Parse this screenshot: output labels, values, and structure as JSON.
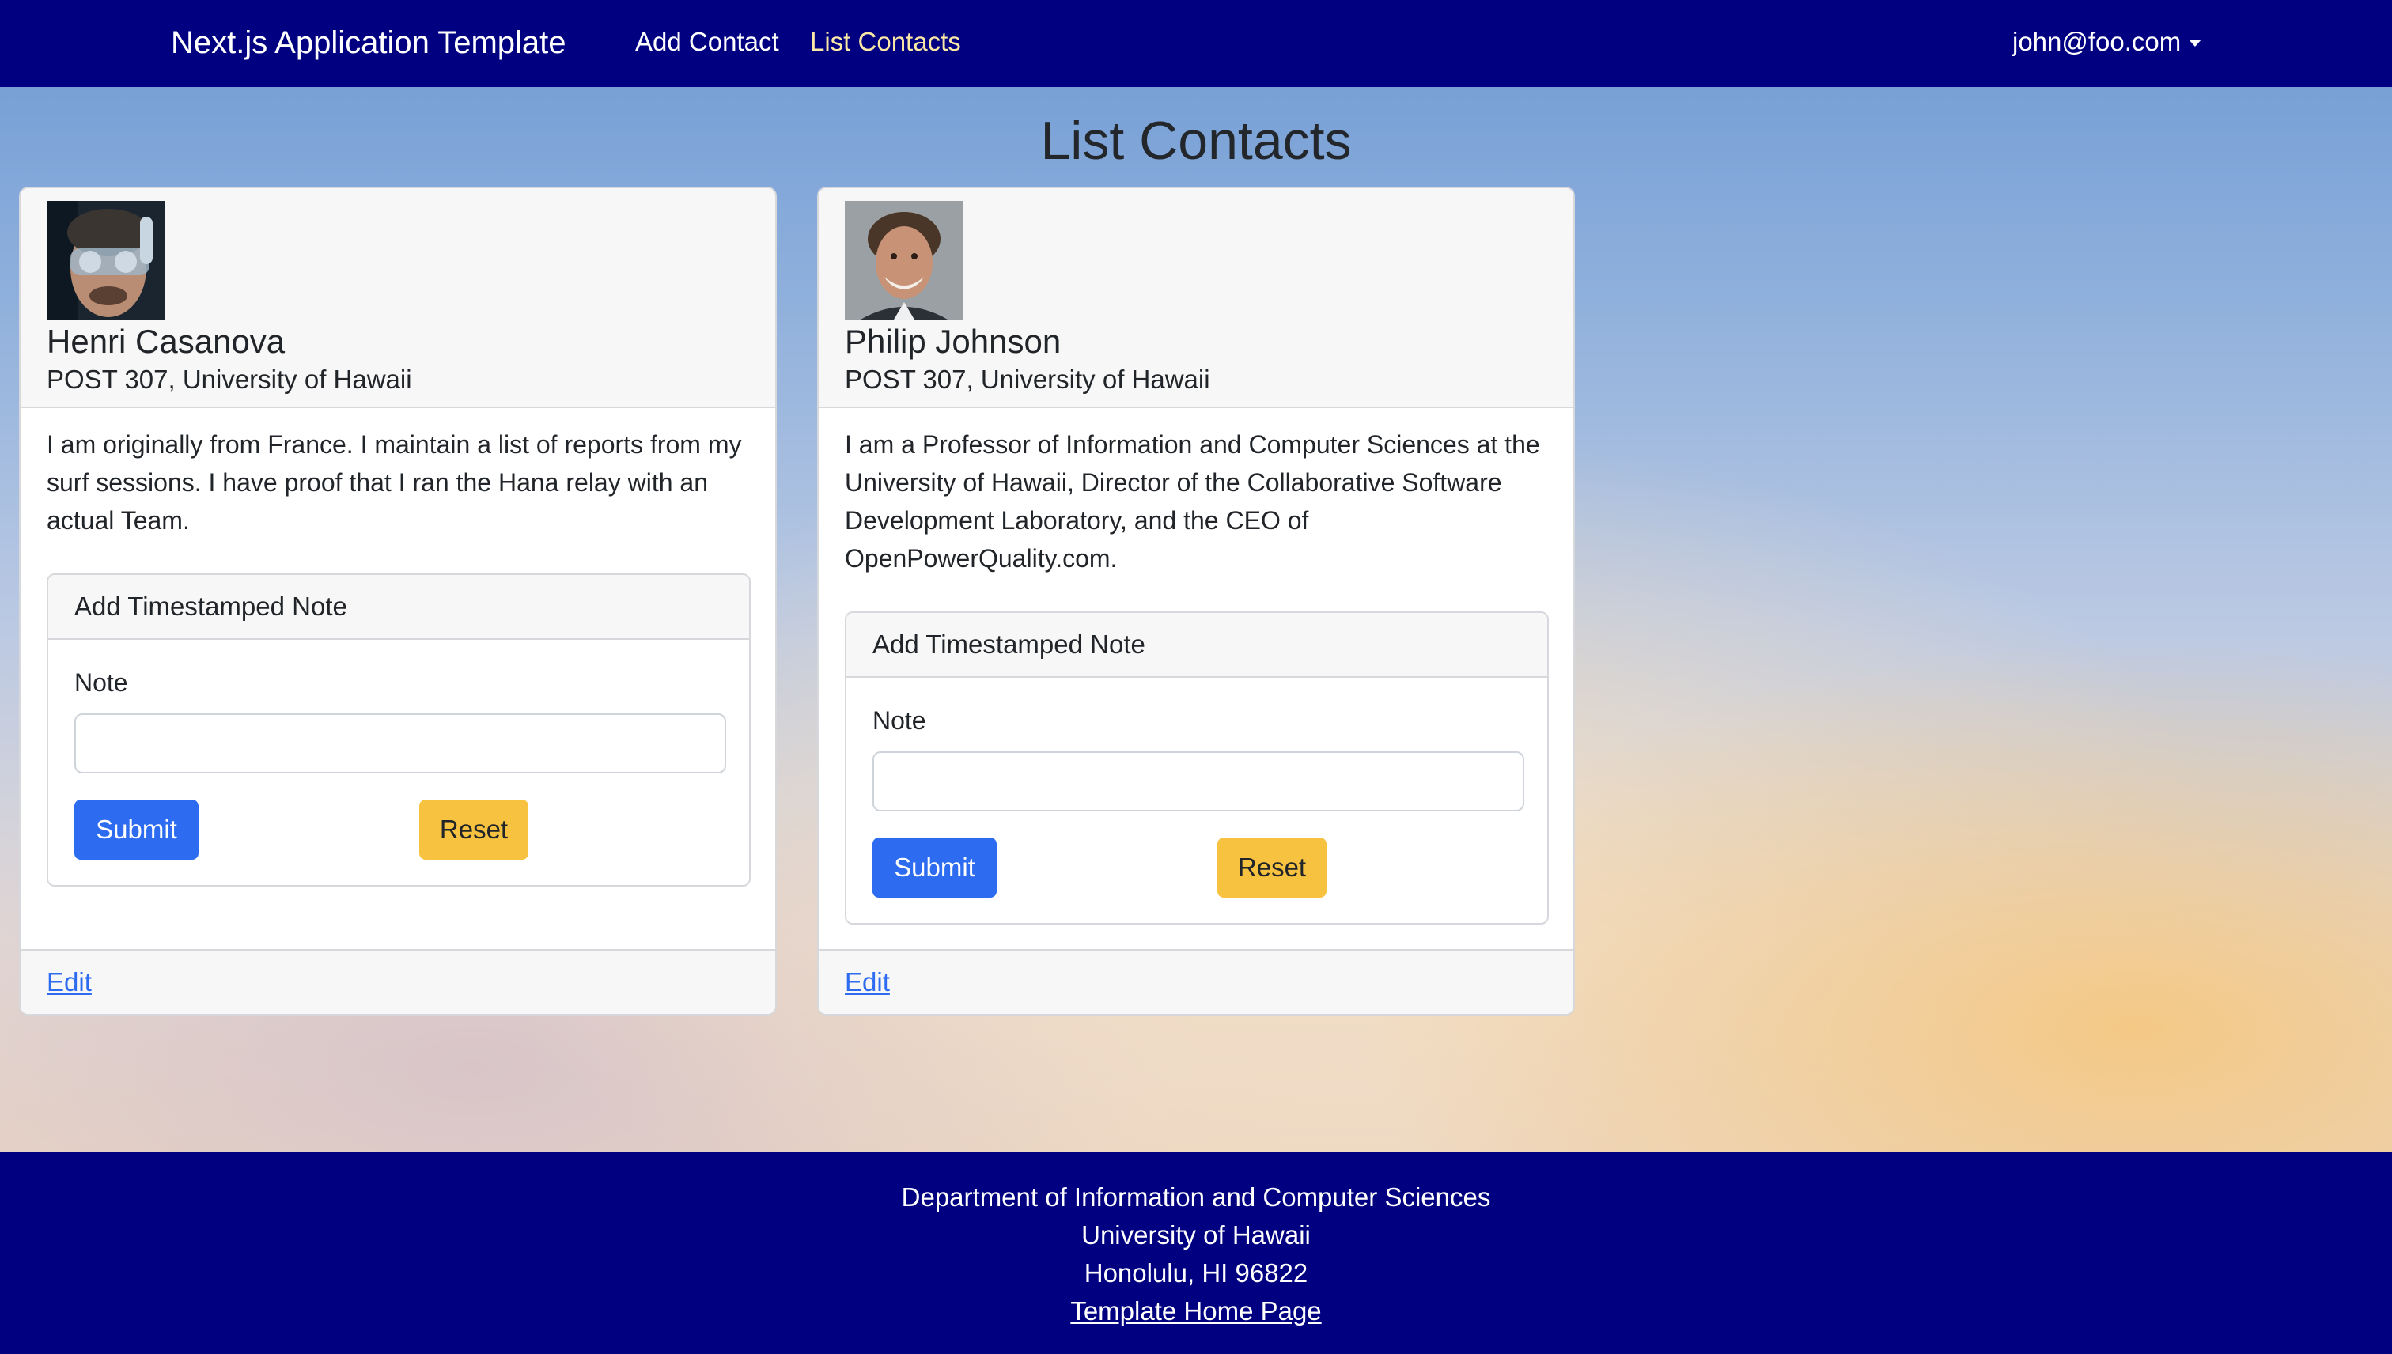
{
  "navbar": {
    "brand": "Next.js Application Template",
    "links": [
      {
        "label": "Add Contact",
        "active": false
      },
      {
        "label": "List Contacts",
        "active": true
      }
    ],
    "user_email": "john@foo.com"
  },
  "page": {
    "title": "List Contacts"
  },
  "contacts": [
    {
      "name": "Henri Casanova",
      "address": "POST 307, University of Hawaii",
      "description": "I am originally from France. I maintain a list of reports from my surf sessions. I have proof that I ran the Hana relay with an actual Team.",
      "note_form": {
        "title": "Add Timestamped Note",
        "label": "Note",
        "value": "",
        "submit_label": "Submit",
        "reset_label": "Reset"
      },
      "edit_label": "Edit"
    },
    {
      "name": "Philip Johnson",
      "address": "POST 307, University of Hawaii",
      "description": "I am a Professor of Information and Computer Sciences at the University of Hawaii, Director of the Collaborative Software Development Laboratory, and the CEO of OpenPowerQuality.com.",
      "note_form": {
        "title": "Add Timestamped Note",
        "label": "Note",
        "value": "",
        "submit_label": "Submit",
        "reset_label": "Reset"
      },
      "edit_label": "Edit"
    }
  ],
  "footer": {
    "lines": [
      "Department of Information and Computer Sciences",
      "University of Hawaii",
      "Honolulu, HI 96822"
    ],
    "link_label": "Template Home Page"
  },
  "colors": {
    "navbar_bg": "#000080",
    "active_link": "#fde9a6",
    "submit_button": "#2d6cf0",
    "reset_button": "#f7c23f",
    "link": "#2d6cf0"
  }
}
